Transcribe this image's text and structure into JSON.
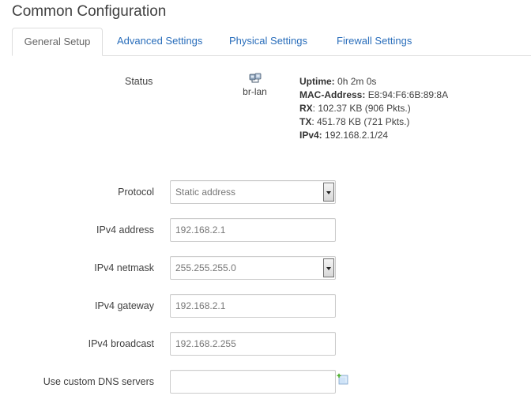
{
  "page": {
    "title": "Common Configuration"
  },
  "tabs": [
    {
      "label": "General Setup",
      "active": true
    },
    {
      "label": "Advanced Settings",
      "active": false
    },
    {
      "label": "Physical Settings",
      "active": false
    },
    {
      "label": "Firewall Settings",
      "active": false
    }
  ],
  "status": {
    "label": "Status",
    "interface_icon": "network-bridge-icon",
    "interface_name": "br-lan",
    "uptime_label": "Uptime:",
    "uptime_value": "0h 2m 0s",
    "mac_label": "MAC-Address:",
    "mac_value": "E8:94:F6:6B:89:8A",
    "rx_label": "RX",
    "rx_value": ": 102.37 KB (906 Pkts.)",
    "tx_label": "TX",
    "tx_value": ": 451.78 KB (721 Pkts.)",
    "ipv4_label": "IPv4:",
    "ipv4_value": "192.168.2.1/24"
  },
  "form": {
    "protocol": {
      "label": "Protocol",
      "value": "Static address"
    },
    "ipv4_address": {
      "label": "IPv4 address",
      "value": "192.168.2.1"
    },
    "ipv4_netmask": {
      "label": "IPv4 netmask",
      "value": "255.255.255.0"
    },
    "ipv4_gateway": {
      "label": "IPv4 gateway",
      "value": "192.168.2.1"
    },
    "ipv4_broadcast": {
      "label": "IPv4 broadcast",
      "value": "192.168.2.255"
    },
    "dns_servers": {
      "label": "Use custom DNS servers",
      "value": "",
      "add_icon": "add-entry-icon"
    }
  }
}
